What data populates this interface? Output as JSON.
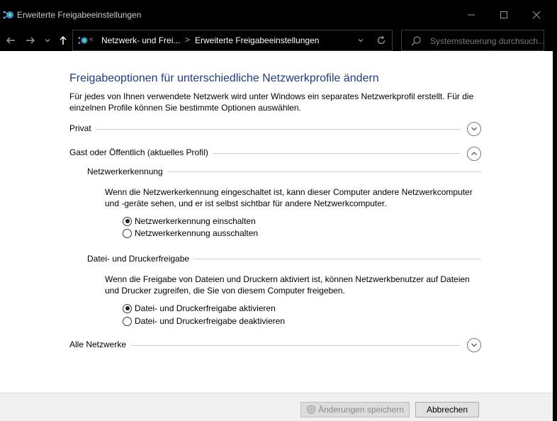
{
  "window": {
    "title": "Erweiterte Freigabeeinstellungen"
  },
  "address": {
    "crumb1": "Netzwerk- und Frei...",
    "separator": ">",
    "crumb2": "Erweiterte Freigabeeinstellungen"
  },
  "search": {
    "placeholder": "Systemsteuerung durchsuch..."
  },
  "page": {
    "title": "Freigabeoptionen für unterschiedliche Netzwerkprofile ändern",
    "intro": "Für jedes von Ihnen verwendete Netzwerk wird unter Windows ein separates Netzwerkprofil erstellt. Für die einzelnen Profile können Sie bestimmte Optionen auswählen."
  },
  "profiles": {
    "private": {
      "label": "Privat",
      "expanded": false
    },
    "guest": {
      "label": "Gast oder Öffentlich (aktuelles Profil)",
      "expanded": true
    },
    "all": {
      "label": "Alle Netzwerke",
      "expanded": false
    }
  },
  "discovery": {
    "heading": "Netzwerkerkennung",
    "description": "Wenn die Netzwerkerkennung eingeschaltet ist, kann dieser Computer andere Netzwerkcomputer und -geräte sehen, und er ist selbst sichtbar für andere Netzwerkcomputer.",
    "options": [
      {
        "label": "Netzwerkerkennung einschalten",
        "selected": true
      },
      {
        "label": "Netzwerkerkennung ausschalten",
        "selected": false
      }
    ]
  },
  "sharing": {
    "heading": "Datei- und Druckerfreigabe",
    "description": "Wenn die Freigabe von Dateien und Druckern aktiviert ist, können Netzwerkbenutzer auf Dateien und Drucker zugreifen, die Sie von diesem Computer freigeben.",
    "options": [
      {
        "label": "Datei- und Druckerfreigabe aktivieren",
        "selected": true
      },
      {
        "label": "Datei- und Druckerfreigabe deaktivieren",
        "selected": false
      }
    ]
  },
  "footer": {
    "save_label": "Änderungen speichern",
    "save_enabled": false,
    "cancel_label": "Abbrechen"
  },
  "colors": {
    "title_blue": "#1e3b8f",
    "titlebar_bg": "#000000"
  }
}
